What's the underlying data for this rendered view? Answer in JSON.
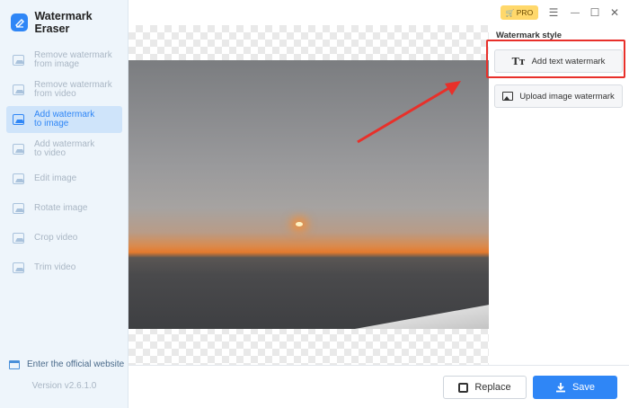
{
  "app": {
    "title": "Watermark Eraser",
    "version": "Version v2.6.1.0",
    "official_website": "Enter the official website"
  },
  "titlebar": {
    "pro_label": "PRO",
    "menu_icon": "☰",
    "minimize_icon": "—",
    "maximize_icon": "☐",
    "close_icon": "✕"
  },
  "sidebar": {
    "items": [
      {
        "label": "Remove watermark\nfrom image",
        "active": false
      },
      {
        "label": "Remove watermark\nfrom video",
        "active": false
      },
      {
        "label": "Add watermark\nto image",
        "active": true
      },
      {
        "label": "Add watermark\nto video",
        "active": false
      },
      {
        "label": "Edit image",
        "active": false
      },
      {
        "label": "Rotate image",
        "active": false
      },
      {
        "label": "Crop video",
        "active": false
      },
      {
        "label": "Trim video",
        "active": false
      }
    ]
  },
  "panel": {
    "section_title": "Watermark style",
    "add_text_label": "Add text watermark",
    "add_text_icon": "Tт",
    "upload_image_label": "Upload image watermark"
  },
  "footer": {
    "replace_label": "Replace",
    "save_label": "Save"
  },
  "colors": {
    "accent": "#2f86f6",
    "highlight": "#e8302a",
    "pro_badge": "#ffd86b"
  }
}
